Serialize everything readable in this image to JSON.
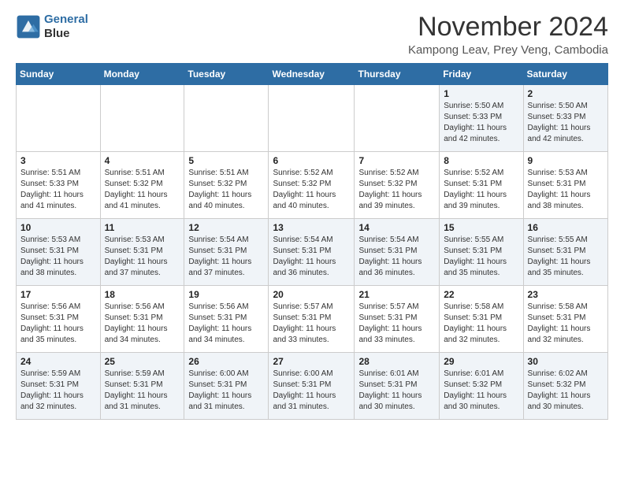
{
  "header": {
    "logo_line1": "General",
    "logo_line2": "Blue",
    "month_title": "November 2024",
    "location": "Kampong Leav, Prey Veng, Cambodia"
  },
  "days_of_week": [
    "Sunday",
    "Monday",
    "Tuesday",
    "Wednesday",
    "Thursday",
    "Friday",
    "Saturday"
  ],
  "weeks": [
    [
      {
        "day": "",
        "info": ""
      },
      {
        "day": "",
        "info": ""
      },
      {
        "day": "",
        "info": ""
      },
      {
        "day": "",
        "info": ""
      },
      {
        "day": "",
        "info": ""
      },
      {
        "day": "1",
        "info": "Sunrise: 5:50 AM\nSunset: 5:33 PM\nDaylight: 11 hours\nand 42 minutes."
      },
      {
        "day": "2",
        "info": "Sunrise: 5:50 AM\nSunset: 5:33 PM\nDaylight: 11 hours\nand 42 minutes."
      }
    ],
    [
      {
        "day": "3",
        "info": "Sunrise: 5:51 AM\nSunset: 5:33 PM\nDaylight: 11 hours\nand 41 minutes."
      },
      {
        "day": "4",
        "info": "Sunrise: 5:51 AM\nSunset: 5:32 PM\nDaylight: 11 hours\nand 41 minutes."
      },
      {
        "day": "5",
        "info": "Sunrise: 5:51 AM\nSunset: 5:32 PM\nDaylight: 11 hours\nand 40 minutes."
      },
      {
        "day": "6",
        "info": "Sunrise: 5:52 AM\nSunset: 5:32 PM\nDaylight: 11 hours\nand 40 minutes."
      },
      {
        "day": "7",
        "info": "Sunrise: 5:52 AM\nSunset: 5:32 PM\nDaylight: 11 hours\nand 39 minutes."
      },
      {
        "day": "8",
        "info": "Sunrise: 5:52 AM\nSunset: 5:31 PM\nDaylight: 11 hours\nand 39 minutes."
      },
      {
        "day": "9",
        "info": "Sunrise: 5:53 AM\nSunset: 5:31 PM\nDaylight: 11 hours\nand 38 minutes."
      }
    ],
    [
      {
        "day": "10",
        "info": "Sunrise: 5:53 AM\nSunset: 5:31 PM\nDaylight: 11 hours\nand 38 minutes."
      },
      {
        "day": "11",
        "info": "Sunrise: 5:53 AM\nSunset: 5:31 PM\nDaylight: 11 hours\nand 37 minutes."
      },
      {
        "day": "12",
        "info": "Sunrise: 5:54 AM\nSunset: 5:31 PM\nDaylight: 11 hours\nand 37 minutes."
      },
      {
        "day": "13",
        "info": "Sunrise: 5:54 AM\nSunset: 5:31 PM\nDaylight: 11 hours\nand 36 minutes."
      },
      {
        "day": "14",
        "info": "Sunrise: 5:54 AM\nSunset: 5:31 PM\nDaylight: 11 hours\nand 36 minutes."
      },
      {
        "day": "15",
        "info": "Sunrise: 5:55 AM\nSunset: 5:31 PM\nDaylight: 11 hours\nand 35 minutes."
      },
      {
        "day": "16",
        "info": "Sunrise: 5:55 AM\nSunset: 5:31 PM\nDaylight: 11 hours\nand 35 minutes."
      }
    ],
    [
      {
        "day": "17",
        "info": "Sunrise: 5:56 AM\nSunset: 5:31 PM\nDaylight: 11 hours\nand 35 minutes."
      },
      {
        "day": "18",
        "info": "Sunrise: 5:56 AM\nSunset: 5:31 PM\nDaylight: 11 hours\nand 34 minutes."
      },
      {
        "day": "19",
        "info": "Sunrise: 5:56 AM\nSunset: 5:31 PM\nDaylight: 11 hours\nand 34 minutes."
      },
      {
        "day": "20",
        "info": "Sunrise: 5:57 AM\nSunset: 5:31 PM\nDaylight: 11 hours\nand 33 minutes."
      },
      {
        "day": "21",
        "info": "Sunrise: 5:57 AM\nSunset: 5:31 PM\nDaylight: 11 hours\nand 33 minutes."
      },
      {
        "day": "22",
        "info": "Sunrise: 5:58 AM\nSunset: 5:31 PM\nDaylight: 11 hours\nand 32 minutes."
      },
      {
        "day": "23",
        "info": "Sunrise: 5:58 AM\nSunset: 5:31 PM\nDaylight: 11 hours\nand 32 minutes."
      }
    ],
    [
      {
        "day": "24",
        "info": "Sunrise: 5:59 AM\nSunset: 5:31 PM\nDaylight: 11 hours\nand 32 minutes."
      },
      {
        "day": "25",
        "info": "Sunrise: 5:59 AM\nSunset: 5:31 PM\nDaylight: 11 hours\nand 31 minutes."
      },
      {
        "day": "26",
        "info": "Sunrise: 6:00 AM\nSunset: 5:31 PM\nDaylight: 11 hours\nand 31 minutes."
      },
      {
        "day": "27",
        "info": "Sunrise: 6:00 AM\nSunset: 5:31 PM\nDaylight: 11 hours\nand 31 minutes."
      },
      {
        "day": "28",
        "info": "Sunrise: 6:01 AM\nSunset: 5:31 PM\nDaylight: 11 hours\nand 30 minutes."
      },
      {
        "day": "29",
        "info": "Sunrise: 6:01 AM\nSunset: 5:32 PM\nDaylight: 11 hours\nand 30 minutes."
      },
      {
        "day": "30",
        "info": "Sunrise: 6:02 AM\nSunset: 5:32 PM\nDaylight: 11 hours\nand 30 minutes."
      }
    ]
  ]
}
